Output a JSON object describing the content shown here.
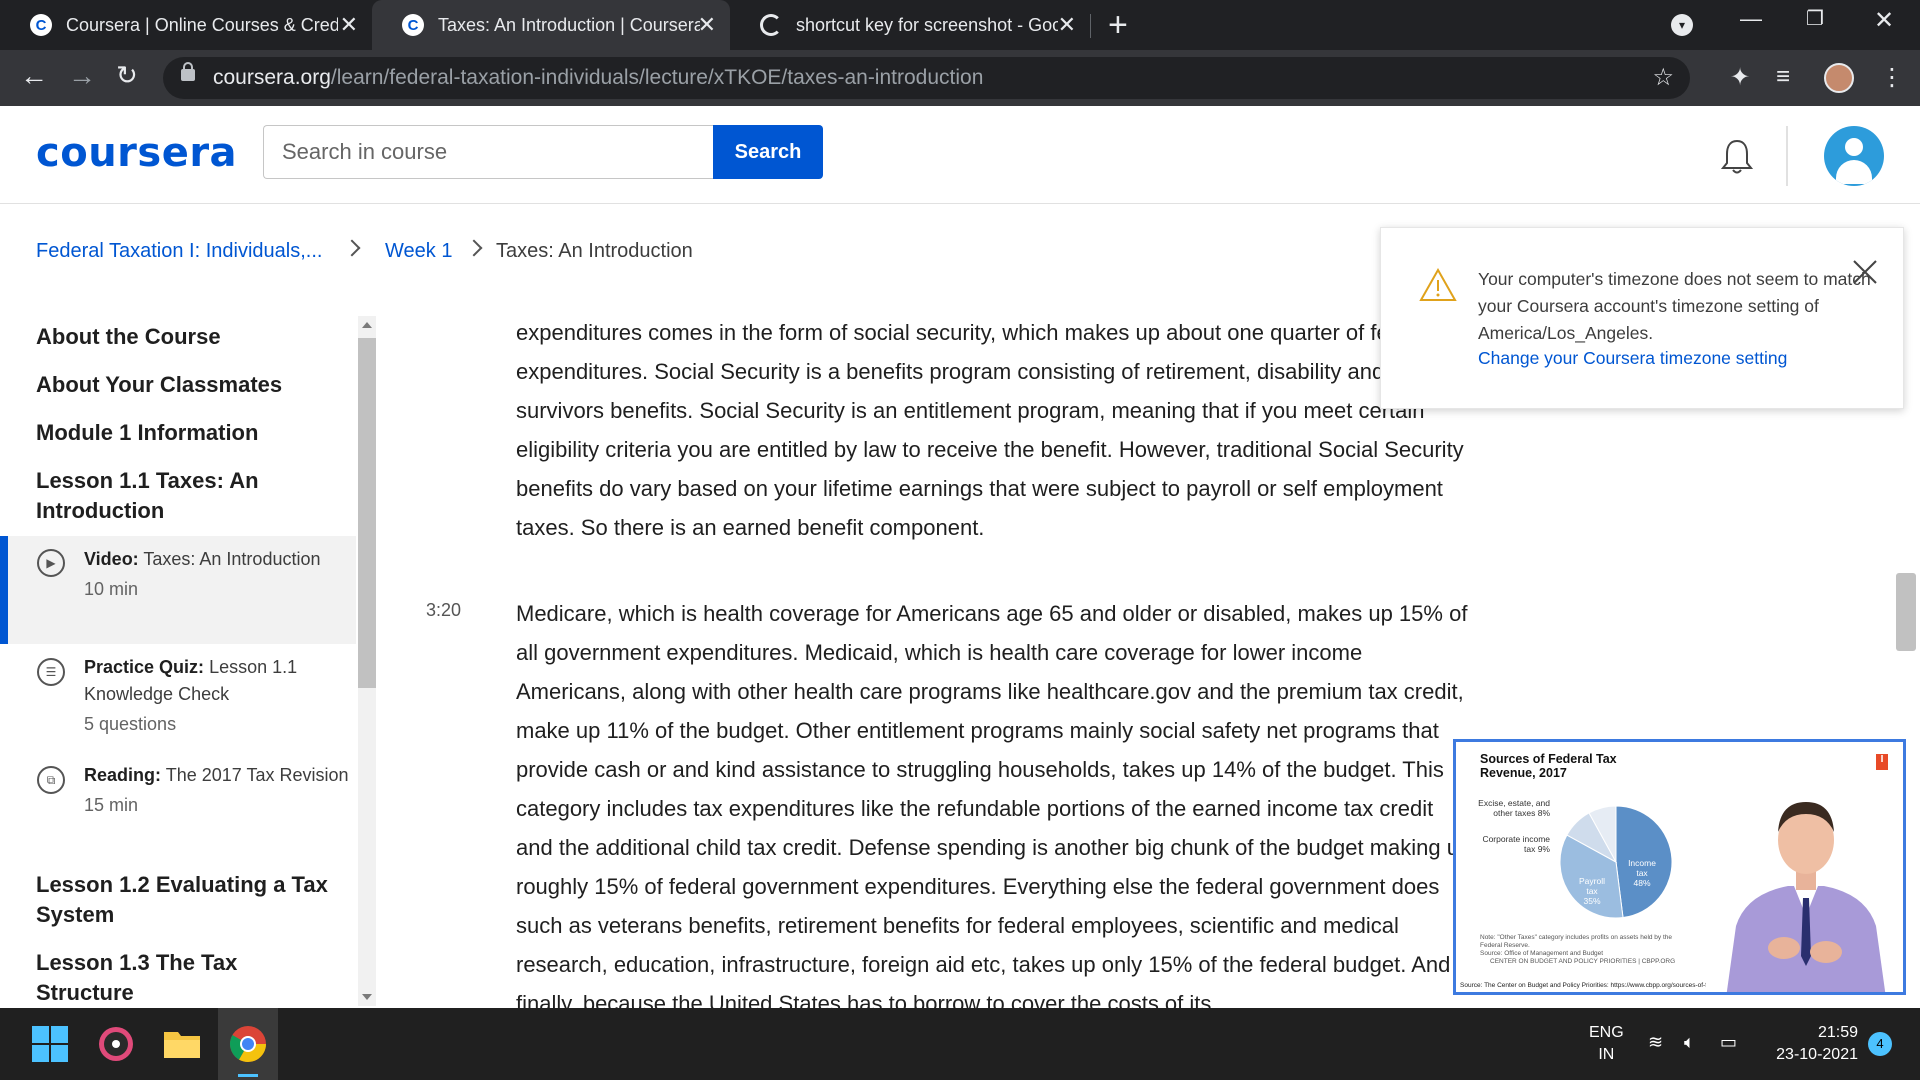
{
  "browser": {
    "tabs": [
      {
        "title": "Coursera | Online Courses & Credentials",
        "active": false
      },
      {
        "title": "Taxes: An Introduction | Coursera",
        "active": true
      },
      {
        "title": "shortcut key for screenshot - Google Search",
        "active": false
      }
    ],
    "url_host": "coursera.org",
    "url_path": "/learn/federal-taxation-individuals/lecture/xTKOE/taxes-an-introduction"
  },
  "header": {
    "logo": "coursera",
    "search_placeholder": "Search in course",
    "search_button": "Search"
  },
  "breadcrumb": {
    "course": "Federal Taxation I: Individuals,...",
    "week": "Week 1",
    "current": "Taxes: An Introduction"
  },
  "sidebar": {
    "headings": [
      "About the Course",
      "About Your Classmates",
      "Module 1 Information",
      "Lesson 1.1 Taxes: An Introduction",
      "Lesson 1.2 Evaluating a Tax System",
      "Lesson 1.3 The Tax Structure"
    ],
    "items": [
      {
        "type": "Video:",
        "title": "Taxes: An Introduction",
        "meta": "10 min",
        "icon": "play-icon"
      },
      {
        "type": "Practice Quiz:",
        "title": "Lesson 1.1 Knowledge Check",
        "meta": "5 questions",
        "icon": "quiz-icon"
      },
      {
        "type": "Reading:",
        "title": "The 2017 Tax Revision",
        "meta": "15 min",
        "icon": "book-icon"
      }
    ]
  },
  "transcript": {
    "para1": "expenditures comes in the form of social security, which makes up about one quarter of federal expenditures. Social Security is a benefits program consisting of retirement, disability and survivors benefits. Social Security is an entitlement program, meaning that if you meet certain eligibility criteria you are entitled by law to receive the benefit. However, traditional Social Security benefits do vary based on your lifetime earnings that were subject to payroll or self employment taxes. So there is an earned benefit component.",
    "timestamp": "3:20",
    "para2": "Medicare, which is health coverage for Americans age 65 and older or disabled, makes up 15% of all government expenditures. Medicaid, which is health care coverage for lower income Americans, along with other health care programs like healthcare.gov and the premium tax credit, make up 11% of the budget. Other entitlement programs mainly social safety net programs that provide cash or and kind assistance to struggling households, takes up 14% of the budget. This category includes tax expenditures like the refundable portions of the earned income tax credit and the additional child tax credit. Defense spending is another big chunk of the budget making up roughly 15% of federal government expenditures. Everything else the federal government does such as veterans benefits, retirement benefits for federal employees, scientific and medical research, education, infrastructure, foreign aid etc, takes up only 15% of the federal budget. And finally, because the United States has to borrow to cover the costs of its"
  },
  "timezone_notice": {
    "text": "Your computer's timezone does not seem to match your Coursera account's timezone setting of America/Los_Angeles.",
    "link": "Change your Coursera timezone setting"
  },
  "video_slide": {
    "title": "Sources of Federal Tax Revenue, 2017",
    "labels": {
      "excise": "Excise, estate, and other taxes 8%",
      "corporate": "Corporate income tax 9%",
      "payroll": "Payroll tax 35%",
      "income": "Income tax 48%"
    },
    "note": "Note: \"Other Taxes\" category includes profits on assets held by the Federal Reserve.",
    "source_line": "Source: Office of Management and Budget",
    "org": "CENTER ON BUDGET AND POLICY PRIORITIES | CBPP.ORG",
    "source": "Source: The Center on Budget and Policy Priorities: https://www.cbpp.org/sources-of-fed..."
  },
  "chart_data": {
    "type": "pie",
    "title": "Sources of Federal Tax Revenue, 2017",
    "categories": [
      "Income tax",
      "Payroll tax",
      "Corporate income tax",
      "Excise, estate, and other taxes"
    ],
    "values": [
      48,
      35,
      9,
      8
    ],
    "colors": [
      "#5b8fc7",
      "#9bbde0",
      "#cfdcec",
      "#e6ecf4"
    ]
  },
  "taskbar": {
    "lang_top": "ENG",
    "lang_bottom": "IN",
    "time": "21:59",
    "date": "23-10-2021",
    "notifications": "4"
  }
}
